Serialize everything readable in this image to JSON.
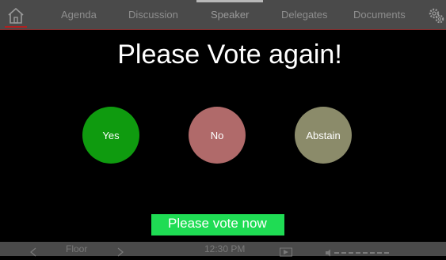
{
  "nav": {
    "tabs": [
      {
        "label": "Agenda"
      },
      {
        "label": "Discussion"
      },
      {
        "label": "Speaker"
      },
      {
        "label": "Delegates"
      },
      {
        "label": "Documents"
      }
    ],
    "active_tab": "Speaker",
    "home_icon": "home-icon",
    "settings_icon": "gear-icon"
  },
  "main": {
    "title": "Please Vote again!",
    "options": [
      {
        "label": "Yes",
        "color": "#0f9b0f"
      },
      {
        "label": "No",
        "color": "#b06a6a"
      },
      {
        "label": "Abstain",
        "color": "#8b8b6a"
      }
    ],
    "banner": "Please vote now"
  },
  "bottom": {
    "channel_label": "Floor",
    "time": "12:30 PM"
  },
  "colors": {
    "bar_background": "#4a4a4a",
    "banner_green": "#1fdc54",
    "accent_red": "#b22020"
  }
}
